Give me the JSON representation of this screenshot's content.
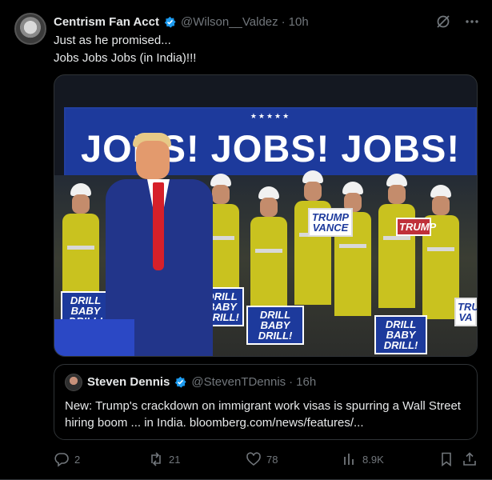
{
  "author": {
    "name": "Centrism Fan Acct",
    "handle": "@Wilson__Valdez",
    "separator": "·",
    "time": "10h"
  },
  "tweet": {
    "line1": "Just as he promised...",
    "line2": "Jobs Jobs Jobs (in India)!!!"
  },
  "image": {
    "stars": "★★★★★",
    "banner": "JOBS! JOBS! JOBS!",
    "signs": [
      "DRILL BABY DRILL!",
      "DRILL BABY DRILL!",
      "DRILL BABY DRILL!",
      "DRILL BABY DRILL!",
      "TRUMP VANCE",
      "TRUMP",
      "TRU VA"
    ]
  },
  "quote": {
    "name": "Steven Dennis",
    "handle": "@StevenTDennis",
    "separator": "·",
    "time": "16h",
    "text": "New: Trump's crackdown on immigrant work visas is spurring a Wall Street hiring boom ... in India. bloomberg.com/news/features/..."
  },
  "actions": {
    "replies": "2",
    "reposts": "21",
    "likes": "78",
    "views": "8.9K"
  },
  "colors": {
    "background": "#000000",
    "text": "#e7e9ea",
    "muted": "#71767b",
    "verified": "#1d9bf0",
    "border": "#2f3336"
  }
}
